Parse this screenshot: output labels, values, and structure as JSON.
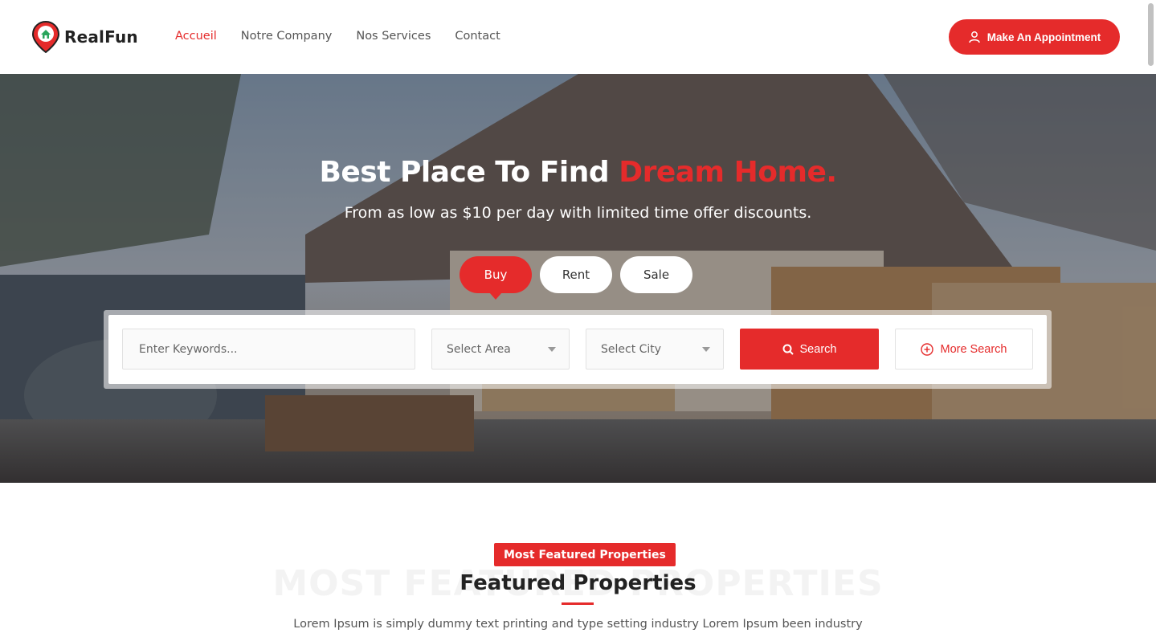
{
  "header": {
    "logo_text": "RealFun",
    "nav": [
      "Accueil",
      "Notre Company",
      "Nos Services",
      "Contact"
    ],
    "active_nav": "Accueil",
    "cta_label": "Make An Appointment"
  },
  "hero": {
    "title_main": "Best Place To Find ",
    "title_accent": "Dream Home.",
    "subtitle": "From as low as $10 per day with limited time offer discounts.",
    "tabs": [
      "Buy",
      "Rent",
      "Sale"
    ],
    "active_tab": "Buy"
  },
  "search": {
    "keyword_placeholder": "Enter Keywords...",
    "area_label": "Select Area",
    "city_label": "Select City",
    "search_label": "Search",
    "more_label": "More Search"
  },
  "featured": {
    "ghost_text": "MOST FEATURED PROPERTIES",
    "badge": "Most Featured Properties",
    "title": "Featured Properties",
    "description": "Lorem Ipsum is simply dummy text printing and type setting industry Lorem Ipsum been industry"
  },
  "colors": {
    "accent": "#e52b2b"
  },
  "icons": {
    "logo": "map-pin-home-icon",
    "cta": "user-icon",
    "search": "search-icon",
    "more": "plus-circle-icon",
    "dropdown": "caret-down-icon"
  }
}
